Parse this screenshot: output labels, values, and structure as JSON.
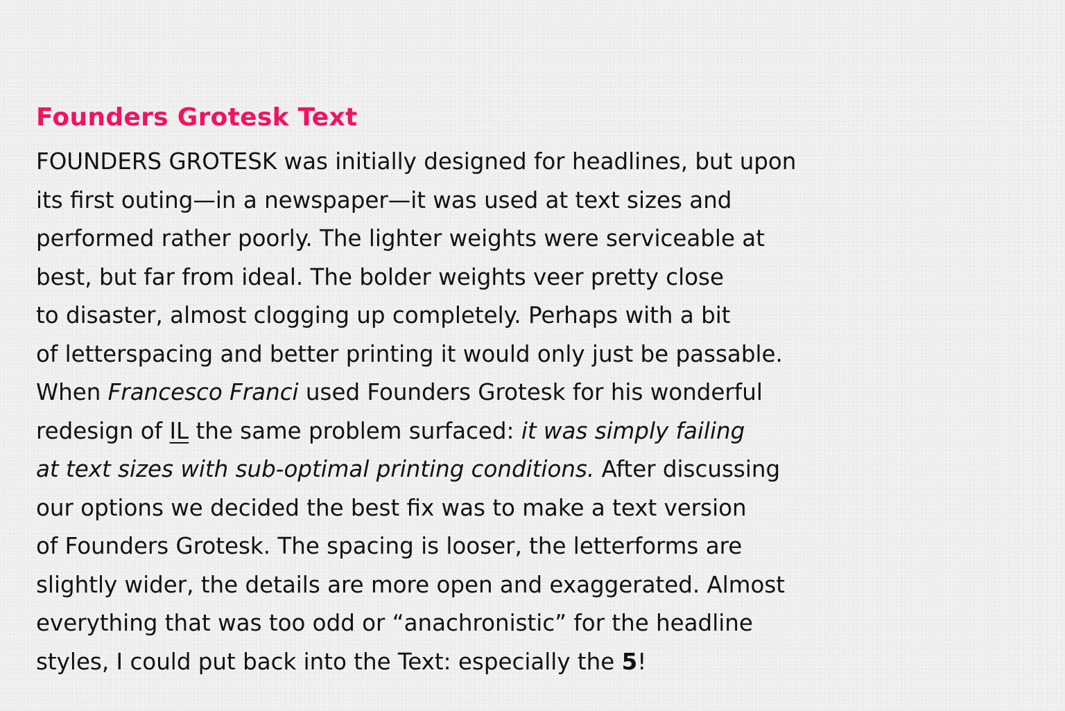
{
  "title": "Founders Grotesk Text",
  "accent_color": "#ef1462",
  "text_color": "#121212",
  "lines": [
    {
      "a": "FOUNDERS GROTESK was initially designed for headlines, but upon"
    },
    {
      "a": "its first outing—in a newspaper—it was used at text sizes and"
    },
    {
      "a": "performed rather poorly. The lighter weights were serviceable at"
    },
    {
      "a": "best, but far from ideal. The bolder weights veer pretty close"
    },
    {
      "a": "to disaster, almost clogging up completely. Perhaps with a bit"
    },
    {
      "a": "of letterspacing and better printing it would only just be passable."
    },
    {
      "a": "When ",
      "b_italic": "Francesco Franci",
      "c": " used Founders Grotesk for his wonderful"
    },
    {
      "a": "redesign of ",
      "b_underline": "IL",
      "c": " the same problem surfaced: ",
      "d_italic": "it was simply failing"
    },
    {
      "a_italic": "at text sizes with sub-optimal printing conditions.",
      "b": " After discussing"
    },
    {
      "a": "our options we decided the best fix was to make a text version"
    },
    {
      "a": "of Founders Grotesk. The spacing is looser, the letterforms are"
    },
    {
      "a": "slightly wider, the details are more open and exaggerated. Almost"
    },
    {
      "a": "everything that was too odd or “anachronistic” for the headline"
    },
    {
      "a": "styles, I could put back into the Text: especially the ",
      "b_bold": "5",
      "c": "!"
    }
  ]
}
